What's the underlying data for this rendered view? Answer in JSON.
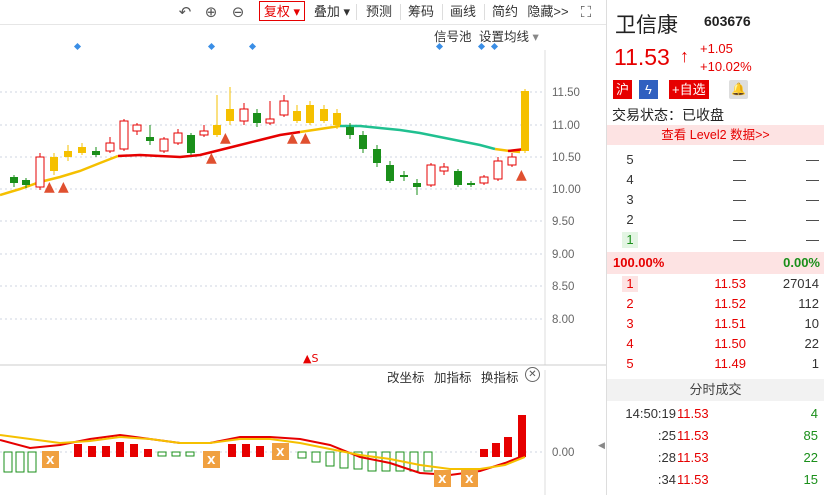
{
  "toolbar": {
    "undo_icon": "undo-icon",
    "zoom_in_icon": "zoom-in-icon",
    "zoom_out_icon": "zoom-out-icon",
    "fuquan": "复权",
    "dieja": "叠加",
    "yuce": "预测",
    "chouma": "筹码",
    "huaxian": "画线",
    "jianyue": "简约",
    "yincang": "隐藏>>",
    "fullscreen_icon": "fullscreen-icon"
  },
  "main_chart": {
    "signal_pool": "信号池",
    "set_ma": "设置均线",
    "price_ticks": [
      "11.50",
      "11.00",
      "10.50",
      "10.00",
      "9.50",
      "9.00",
      "8.50",
      "8.00"
    ],
    "colors": {
      "up": "#e60000",
      "down": "#1a8f1a",
      "yellow": "#f5c000",
      "ma_red": "#e60000",
      "ma_yellow": "#f5c000",
      "ma_teal": "#20c090",
      "marker": "#3a8ee6"
    }
  },
  "sub_chart": {
    "change_coord": "改坐标",
    "add_indicator": "加指标",
    "switch_indicator": "换指标",
    "zero_tick": "0.00",
    "close_icon": "close-circle-icon"
  },
  "stock": {
    "name": "卫信康",
    "code": "603676",
    "price": "11.53",
    "change": "+1.05",
    "change_pct": "+10.02%",
    "exchange_badge": "沪",
    "add_watchlist": "+自选",
    "trade_status": "交易状态：已收盘",
    "level2": "查看 Level2 数据>>"
  },
  "asks": [
    {
      "level": "5",
      "price": "—",
      "vol": "—"
    },
    {
      "level": "4",
      "price": "—",
      "vol": "—"
    },
    {
      "level": "3",
      "price": "—",
      "vol": "—"
    },
    {
      "level": "2",
      "price": "—",
      "vol": "—"
    },
    {
      "level": "1",
      "price": "—",
      "vol": "—"
    }
  ],
  "ratio": {
    "left": "100.00%",
    "right": "0.00%"
  },
  "bids": [
    {
      "level": "1",
      "price": "11.53",
      "vol": "27014"
    },
    {
      "level": "2",
      "price": "11.52",
      "vol": "112"
    },
    {
      "level": "3",
      "price": "11.51",
      "vol": "10"
    },
    {
      "level": "4",
      "price": "11.50",
      "vol": "22"
    },
    {
      "level": "5",
      "price": "11.49",
      "vol": "1"
    }
  ],
  "ticks_title": "分时成交",
  "ticks": [
    {
      "time": "14:50:19",
      "price": "11.53",
      "vol": "4"
    },
    {
      "time": ":25",
      "price": "11.53",
      "vol": "85"
    },
    {
      "time": ":28",
      "price": "11.53",
      "vol": "22"
    },
    {
      "time": ":34",
      "price": "11.53",
      "vol": "15"
    }
  ]
}
